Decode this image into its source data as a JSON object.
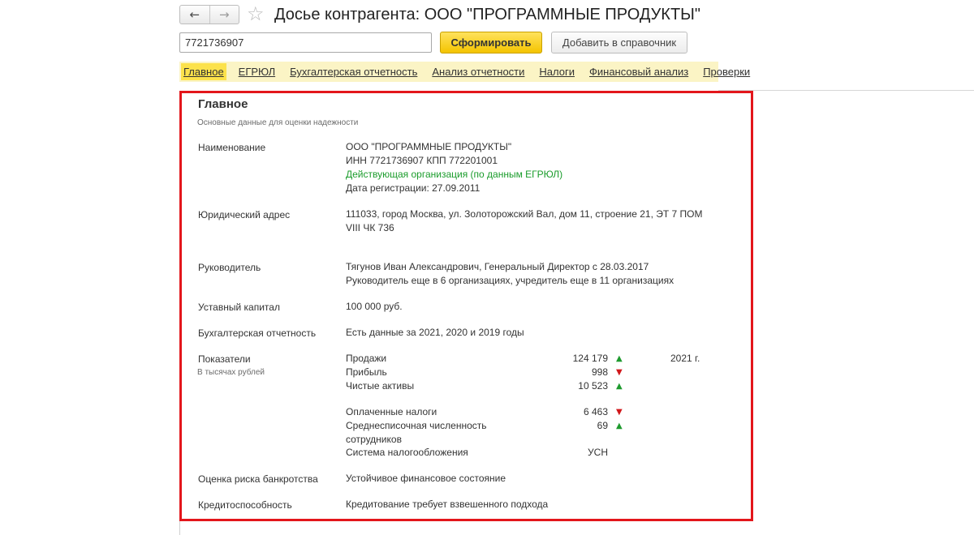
{
  "header": {
    "back_icon": "←",
    "forward_icon": "→",
    "star_icon": "☆",
    "title": "Досье контрагента: ООО \"ПРОГРАММНЫЕ ПРОДУКТЫ\""
  },
  "search": {
    "inn_value": "7721736907",
    "generate_label": "Сформировать",
    "add_label": "Добавить в справочник"
  },
  "tabs": [
    {
      "label": "Главное",
      "active": true
    },
    {
      "label": "ЕГРЮЛ",
      "active": false
    },
    {
      "label": "Бухгалтерская отчетность",
      "active": false
    },
    {
      "label": "Анализ отчетности",
      "active": false
    },
    {
      "label": "Налоги",
      "active": false
    },
    {
      "label": "Финансовый анализ",
      "active": false
    },
    {
      "label": "Проверки",
      "active": false
    }
  ],
  "main": {
    "title": "Главное",
    "subtitle": "Основные данные для оценки надежности",
    "name": {
      "label": "Наименование",
      "line1": "ООО \"ПРОГРАММНЫЕ ПРОДУКТЫ\"",
      "line2": "ИНН 7721736907 КПП 772201001",
      "status": "Действующая организация (по данным ЕГРЮЛ)",
      "reg_date": "Дата регистрации: 27.09.2011"
    },
    "address": {
      "label": "Юридический адрес",
      "line1": "111033, город Москва, ул. Золоторожский Вал, дом 11, строение 21, ЭТ 7 ПОМ",
      "line2": "VIII ЧК 736"
    },
    "director": {
      "label": "Руководитель",
      "line1": "Тягунов Иван Александрович, Генеральный Директор с 28.03.2017",
      "line2": "Руководитель еще в 6 организациях, учредитель еще в 11 организациях"
    },
    "capital": {
      "label": "Уставный капитал",
      "value": "100 000 руб."
    },
    "reporting": {
      "label": "Бухгалтерская отчетность",
      "value": "Есть данные за 2021, 2020 и 2019 годы"
    },
    "indicators": {
      "label": "Показатели",
      "sublabel": "В тысячах рублей",
      "year": "2021 г.",
      "items": [
        {
          "name": "Продажи",
          "value": "124 179",
          "trend": "up"
        },
        {
          "name": "Прибыль",
          "value": "998",
          "trend": "down"
        },
        {
          "name": "Чистые активы",
          "value": "10 523",
          "trend": "up"
        },
        {
          "name": "Оплаченные налоги",
          "value": "6 463",
          "trend": "down"
        },
        {
          "name_line1": "Среднесписочная численность",
          "name_line2": "сотрудников",
          "value": "69",
          "trend": "up"
        },
        {
          "name": "Система налогообложения",
          "value": "УСН",
          "trend": ""
        }
      ]
    },
    "bankruptcy": {
      "label": "Оценка риска банкротства",
      "value": "Устойчивое финансовое состояние"
    },
    "credit": {
      "label": "Кредитоспособность",
      "value": "Кредитование требует взвешенного подхода"
    }
  },
  "colors": {
    "frame": "#e3161b",
    "tabs_bg": "#fbf4c5",
    "active_tab": "#fce24b",
    "status_green": "#1a9c2b",
    "trend_up": "#1e9a2e",
    "trend_down": "#d1181b"
  }
}
